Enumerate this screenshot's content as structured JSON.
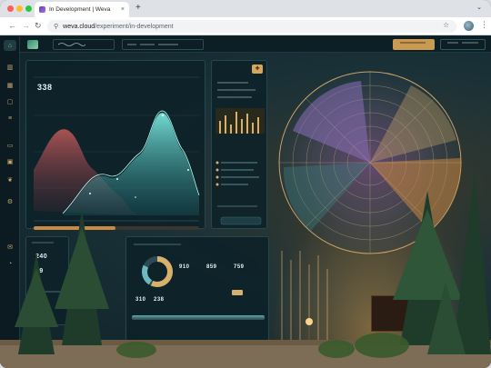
{
  "browser": {
    "tab_title": "In Development | Weva",
    "tab_close": "×",
    "new_tab": "+",
    "tab_menu": "⌄",
    "url_host": "weva.cloud",
    "url_path": "/experiment/in-development",
    "nav_back": "←",
    "nav_forward": "→",
    "nav_reload": "↻",
    "site_info": "⚲",
    "star": "☆",
    "menu": "⋮"
  },
  "dashboard": {
    "wave_panel": {
      "big_value": "338",
      "bottom_pill": "—"
    },
    "side_panel": {
      "badge": "✚"
    },
    "stats_panel": {
      "values": [
        "240",
        "89"
      ]
    },
    "donut_panel": {
      "values": [
        "910",
        "859",
        "759",
        "310",
        "238"
      ]
    }
  },
  "colors": {
    "accent_gold": "#d7b06a",
    "accent_teal": "#5fd6d0",
    "panel_bg": "#0c2128",
    "ring_purple": "#8a6fb8",
    "ring_orange": "#c9863f"
  },
  "icons": {
    "sidebar": [
      "home-icon",
      "chart-icon",
      "grid-icon",
      "box-icon",
      "layers-icon",
      "folder-icon",
      "wallet-icon",
      "leaf-icon",
      "settings-icon",
      "mail-icon"
    ]
  }
}
